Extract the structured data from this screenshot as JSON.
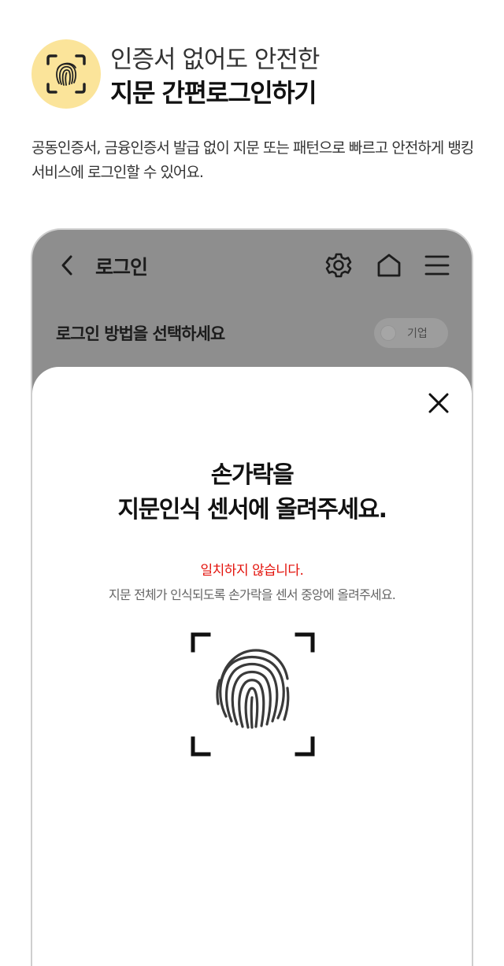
{
  "hero": {
    "icon": "fingerprint-icon",
    "accent_color": "#fbe49a",
    "line1": "인증서 없어도 안전한",
    "line2": "지문 간편로그인하기"
  },
  "intro": {
    "text": "공동인증서, 금융인증서 발급 없이 지문 또는 패턴으로 빠르고 안전하게 뱅킹 서비스에 로그인할 수 있어요."
  },
  "phone": {
    "topbar": {
      "back_icon": "chevron-left-icon",
      "title": "로그인",
      "icons": [
        "gear-icon",
        "home-icon",
        "menu-icon"
      ]
    },
    "method_title": "로그인 방법을 선택하세요",
    "business_toggle": {
      "label": "기업",
      "on": false
    },
    "sheet": {
      "close_icon": "close-icon",
      "title_line1": "손가락을",
      "title_line2": "지문인식 센서에 올려주세요.",
      "error": "일치하지 않습니다.",
      "error_color": "#e3120b",
      "guide": "지문 전체가 인식되도록 손가락을 센서 중앙에 올려주세요.",
      "scan_icon": "fingerprint-icon"
    }
  }
}
